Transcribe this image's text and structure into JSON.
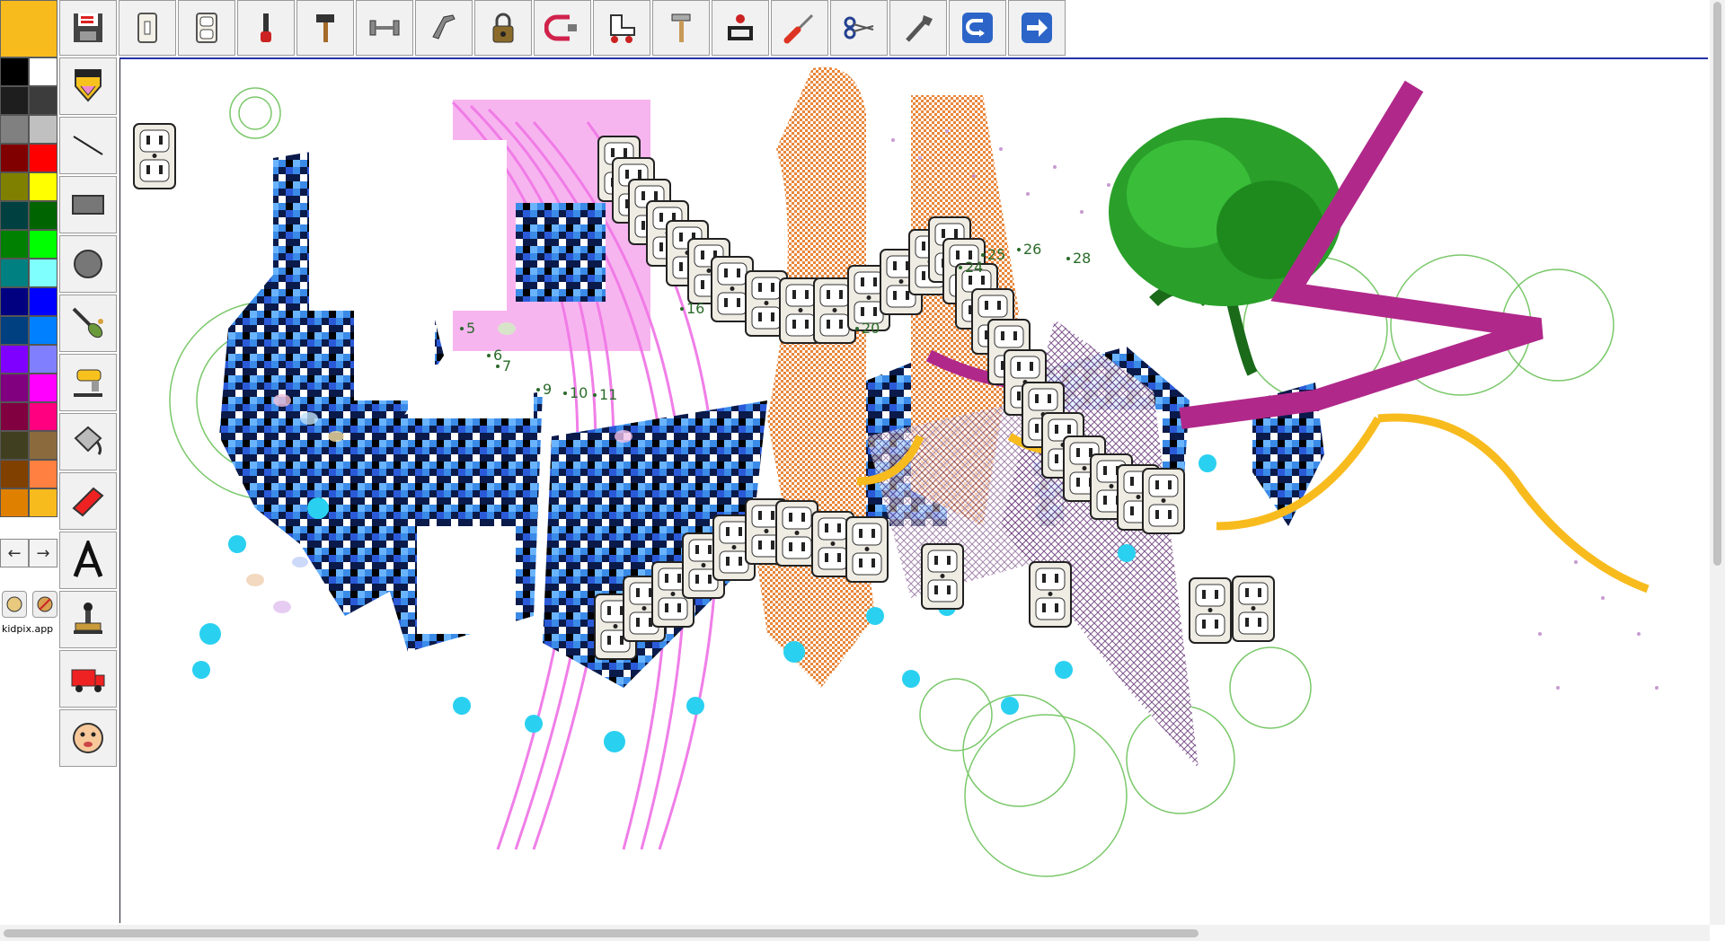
{
  "current_color": "#f8bb1e",
  "toolbar": {
    "buttons": [
      {
        "name": "save-button",
        "icon": "floppy-disk-icon"
      },
      {
        "name": "switch-plate-button",
        "icon": "light-switch-icon"
      },
      {
        "name": "outlet-button",
        "icon": "outlet-icon"
      },
      {
        "name": "flashlight-button",
        "icon": "flashlight-icon"
      },
      {
        "name": "hammer-button",
        "icon": "hammer-icon"
      },
      {
        "name": "dumbbell-button",
        "icon": "dumbbell-icon"
      },
      {
        "name": "stapler-button",
        "icon": "stapler-icon"
      },
      {
        "name": "padlock-button",
        "icon": "padlock-icon"
      },
      {
        "name": "clamp-button",
        "icon": "c-clamp-icon"
      },
      {
        "name": "roller-skate-button",
        "icon": "roller-skate-icon"
      },
      {
        "name": "mallet-button",
        "icon": "mallet-icon"
      },
      {
        "name": "ink-stamp-button",
        "icon": "ink-stamp-icon"
      },
      {
        "name": "screwdriver-button",
        "icon": "screwdriver-icon"
      },
      {
        "name": "scissors-button",
        "icon": "scissors-icon"
      },
      {
        "name": "wrench-button",
        "icon": "wrench-icon"
      },
      {
        "name": "undo-button",
        "icon": "undo-arrow-icon"
      },
      {
        "name": "next-button",
        "icon": "right-arrow-icon"
      }
    ]
  },
  "palette": {
    "colors": [
      [
        "#000000",
        "#ffffff"
      ],
      [
        "#1e1e1e",
        "#3c3c3c"
      ],
      [
        "#808080",
        "#c0c0c0"
      ],
      [
        "#800000",
        "#ff0000"
      ],
      [
        "#808000",
        "#ffff00"
      ],
      [
        "#004040",
        "#006400"
      ],
      [
        "#008000",
        "#00ff00"
      ],
      [
        "#008080",
        "#80ffff"
      ],
      [
        "#000080",
        "#0000ff"
      ],
      [
        "#004080",
        "#0080ff"
      ],
      [
        "#8000ff",
        "#8080ff"
      ],
      [
        "#800080",
        "#ff00ff"
      ],
      [
        "#800040",
        "#ff0080"
      ],
      [
        "#404020",
        "#8b6b3e"
      ],
      [
        "#804000",
        "#ff8040"
      ],
      [
        "#e08000",
        "#f8bb1e"
      ]
    ],
    "prev_label": "←",
    "next_label": "→"
  },
  "app_label": "kidpix.app",
  "tools": [
    {
      "name": "pencil-tool",
      "icon": "pencil-icon"
    },
    {
      "name": "line-tool",
      "icon": "line-icon"
    },
    {
      "name": "rectangle-tool",
      "icon": "rectangle-icon"
    },
    {
      "name": "oval-tool",
      "icon": "circle-icon"
    },
    {
      "name": "paintbrush-tool",
      "icon": "paintbrush-icon"
    },
    {
      "name": "mixer-tool",
      "icon": "mixer-icon"
    },
    {
      "name": "paint-bucket-tool",
      "icon": "paint-bucket-icon"
    },
    {
      "name": "eraser-tool",
      "icon": "eraser-icon"
    },
    {
      "name": "text-tool",
      "icon": "letter-a-icon"
    },
    {
      "name": "stamp-tool",
      "icon": "rubber-stamp-icon"
    },
    {
      "name": "truck-tool",
      "icon": "truck-icon"
    },
    {
      "name": "face-tool",
      "icon": "face-icon"
    }
  ],
  "canvas": {
    "dot_numbers": [
      "5",
      "6",
      "7",
      "9",
      "10",
      "11",
      "16",
      "20",
      "24",
      "25",
      "26",
      "28"
    ]
  }
}
